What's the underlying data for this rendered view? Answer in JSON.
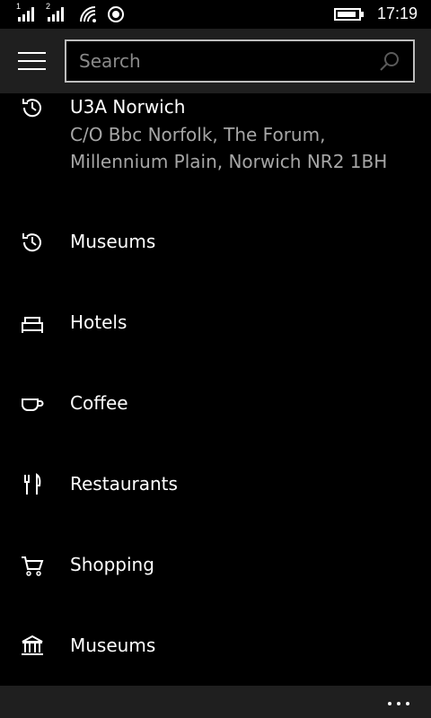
{
  "status_bar": {
    "sim1": "1",
    "sim2": "2",
    "time": "17:19"
  },
  "header": {
    "search_placeholder": "Search"
  },
  "list": {
    "items": [
      {
        "icon": "history-icon",
        "label": "U3A Norwich",
        "address_line1": "C/O Bbc Norfolk, The Forum,",
        "address_line2": "Millennium Plain, Norwich NR2 1BH"
      },
      {
        "icon": "history-icon",
        "label": "Museums"
      },
      {
        "icon": "bed-icon",
        "label": "Hotels"
      },
      {
        "icon": "coffee-cup-icon",
        "label": "Coffee"
      },
      {
        "icon": "fork-knife-icon",
        "label": "Restaurants"
      },
      {
        "icon": "shopping-cart-icon",
        "label": "Shopping"
      },
      {
        "icon": "museum-building-icon",
        "label": "Museums"
      }
    ]
  },
  "colors": {
    "background": "#000000",
    "bar_background": "#1f1f1f",
    "secondary_text": "#a6a6a6",
    "search_border": "#bdbdbd"
  }
}
